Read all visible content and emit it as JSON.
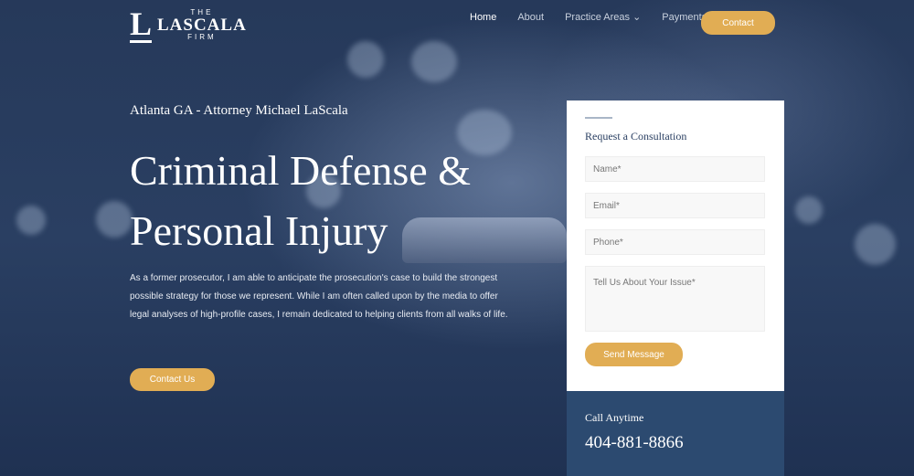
{
  "logo": {
    "the": "THE",
    "name": "LASCALA",
    "firm": "FIRM",
    "mark": "L"
  },
  "nav": {
    "items": [
      "Home",
      "About",
      "Practice Areas",
      "Payments"
    ],
    "contact": "Contact"
  },
  "hero": {
    "subtitle": "Atlanta GA - Attorney Michael LaScala",
    "title_line1": "Criminal Defense &",
    "title_line2": "Personal Injury",
    "description": "As a former prosecutor, I am able to anticipate the prosecution's case to build the strongest possible strategy for those we represent. While I am often called upon by the media to offer legal analyses of high-profile cases, I remain dedicated to helping clients from all walks of life.",
    "cta": "Contact Us"
  },
  "form": {
    "title": "Request a Consultation",
    "name": "Name*",
    "email": "Email*",
    "phone": "Phone*",
    "issue": "Tell Us About Your Issue*",
    "submit": "Send Message"
  },
  "call": {
    "label": "Call Anytime",
    "phone": "404-881-8866"
  },
  "colors": {
    "accent": "#e1ad54",
    "navy": "#233758",
    "call_bg": "#2c4a70"
  }
}
